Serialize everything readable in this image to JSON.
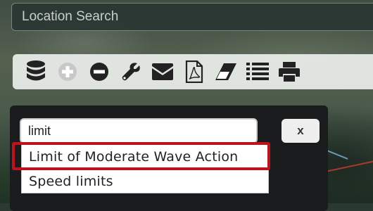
{
  "search": {
    "placeholder": "Location Search"
  },
  "toolbar": {
    "buttons": [
      {
        "icon": "database-icon",
        "color": "#222222"
      },
      {
        "icon": "zoom-in-icon",
        "color": "#c8c8c8"
      },
      {
        "icon": "zoom-out-icon",
        "color": "#222222"
      },
      {
        "icon": "wrench-icon",
        "color": "#222222"
      },
      {
        "icon": "envelope-icon",
        "color": "#222222"
      },
      {
        "icon": "pdf-icon",
        "color": "#222222"
      },
      {
        "icon": "eraser-icon",
        "color": "#222222"
      },
      {
        "icon": "list-icon",
        "color": "#222222"
      },
      {
        "icon": "print-icon",
        "color": "#222222"
      }
    ]
  },
  "dialog": {
    "input_value": "limit",
    "close_label": "x",
    "results": [
      "Limit of Moderate Wave Action",
      "Speed limits"
    ],
    "highlight_color": "#c0121b"
  }
}
